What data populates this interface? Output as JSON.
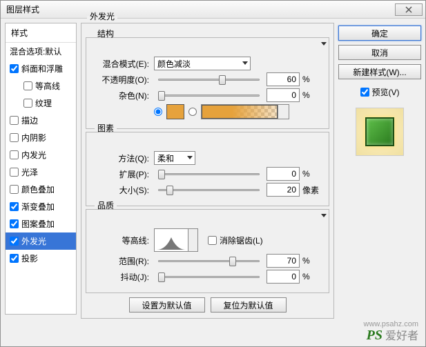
{
  "title": "图层样式",
  "sidebar": {
    "header": "样式",
    "blendDefault": "混合选项:默认",
    "items": [
      {
        "label": "斜面和浮雕",
        "checked": true,
        "indent": false
      },
      {
        "label": "等高线",
        "checked": false,
        "indent": true
      },
      {
        "label": "纹理",
        "checked": false,
        "indent": true
      },
      {
        "label": "描边",
        "checked": false,
        "indent": false
      },
      {
        "label": "内阴影",
        "checked": false,
        "indent": false
      },
      {
        "label": "内发光",
        "checked": false,
        "indent": false
      },
      {
        "label": "光泽",
        "checked": false,
        "indent": false
      },
      {
        "label": "颜色叠加",
        "checked": false,
        "indent": false
      },
      {
        "label": "渐变叠加",
        "checked": true,
        "indent": false
      },
      {
        "label": "图案叠加",
        "checked": true,
        "indent": false
      },
      {
        "label": "外发光",
        "checked": true,
        "indent": false,
        "selected": true
      },
      {
        "label": "投影",
        "checked": true,
        "indent": false
      }
    ]
  },
  "main": {
    "title": "外发光",
    "structure": {
      "legend": "结构",
      "blendMode": {
        "label": "混合模式(E):",
        "value": "颜色减淡"
      },
      "opacity": {
        "label": "不透明度(O):",
        "value": "60",
        "unit": "%",
        "pos": 60
      },
      "noise": {
        "label": "杂色(N):",
        "value": "0",
        "unit": "%",
        "pos": 0
      },
      "colorHex": "#e6a23c"
    },
    "elements": {
      "legend": "图素",
      "technique": {
        "label": "方法(Q):",
        "value": "柔和"
      },
      "spread": {
        "label": "扩展(P):",
        "value": "0",
        "unit": "%",
        "pos": 0
      },
      "size": {
        "label": "大小(S):",
        "value": "20",
        "unit": "像素",
        "pos": 8
      }
    },
    "quality": {
      "legend": "品质",
      "contour": {
        "label": "等高线:"
      },
      "antialias": {
        "label": "消除锯齿(L)",
        "checked": false
      },
      "range": {
        "label": "范围(R):",
        "value": "70",
        "unit": "%",
        "pos": 70
      },
      "jitter": {
        "label": "抖动(J):",
        "value": "0",
        "unit": "%",
        "pos": 0
      }
    },
    "buttons": {
      "default": "设置为默认值",
      "reset": "复位为默认值"
    }
  },
  "right": {
    "ok": "确定",
    "cancel": "取消",
    "newStyle": "新建样式(W)...",
    "preview": "预览(V)"
  },
  "footer": {
    "url": "www.psahz.com",
    "logo": "PS",
    "text": "爱好者"
  }
}
